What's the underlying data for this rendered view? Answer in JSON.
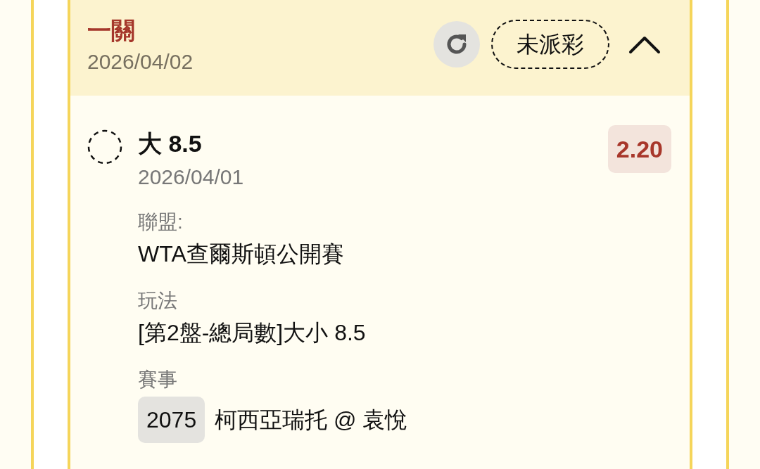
{
  "ticket": {
    "title": "一關",
    "date": "2026/04/02",
    "status": "未派彩",
    "expanded": true
  },
  "selections": [
    {
      "pick": "大 8.5",
      "date": "2026/04/01",
      "odds": "2.20",
      "fields": [
        {
          "label": "聯盟:",
          "value": "WTA查爾斯頓公開賽"
        },
        {
          "label": "玩法",
          "value": "[第2盤-總局數]大小 8.5"
        },
        {
          "label": "賽事",
          "match_id": "2075",
          "value": "柯西亞瑞托 @ 袁悅"
        }
      ]
    }
  ]
}
